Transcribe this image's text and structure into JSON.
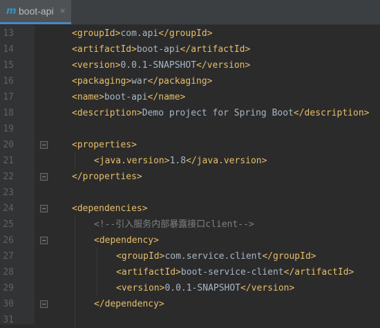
{
  "tab": {
    "label": "boot-api",
    "file_icon": "m",
    "close_glyph": "×"
  },
  "lines": [
    {
      "num": "13",
      "indent": 1,
      "parts": [
        {
          "k": "tag",
          "t": "<groupId>"
        },
        {
          "k": "txt",
          "t": "com.api"
        },
        {
          "k": "tag",
          "t": "</groupId>"
        }
      ]
    },
    {
      "num": "14",
      "indent": 1,
      "parts": [
        {
          "k": "tag",
          "t": "<artifactId>"
        },
        {
          "k": "txt",
          "t": "boot-api"
        },
        {
          "k": "tag",
          "t": "</artifactId>"
        }
      ]
    },
    {
      "num": "15",
      "indent": 1,
      "parts": [
        {
          "k": "tag",
          "t": "<version>"
        },
        {
          "k": "txt",
          "t": "0.0.1-SNAPSHOT"
        },
        {
          "k": "tag",
          "t": "</version>"
        }
      ]
    },
    {
      "num": "16",
      "indent": 1,
      "parts": [
        {
          "k": "tag",
          "t": "<packaging>"
        },
        {
          "k": "txt",
          "t": "war"
        },
        {
          "k": "tag",
          "t": "</packaging>"
        }
      ]
    },
    {
      "num": "17",
      "indent": 1,
      "parts": [
        {
          "k": "tag",
          "t": "<name>"
        },
        {
          "k": "txt",
          "t": "boot-api"
        },
        {
          "k": "tag",
          "t": "</name>"
        }
      ]
    },
    {
      "num": "18",
      "indent": 1,
      "parts": [
        {
          "k": "tag",
          "t": "<description>"
        },
        {
          "k": "txt",
          "t": "Demo project for Spring Boot"
        },
        {
          "k": "tag",
          "t": "</description>"
        }
      ]
    },
    {
      "num": "19",
      "indent": 1,
      "parts": []
    },
    {
      "num": "20",
      "indent": 1,
      "fold": true,
      "parts": [
        {
          "k": "tag",
          "t": "<properties>"
        }
      ]
    },
    {
      "num": "21",
      "indent": 2,
      "parts": [
        {
          "k": "tag",
          "t": "<java.version>"
        },
        {
          "k": "txt",
          "t": "1.8"
        },
        {
          "k": "tag",
          "t": "</java.version>"
        }
      ]
    },
    {
      "num": "22",
      "indent": 1,
      "fold": true,
      "parts": [
        {
          "k": "tag",
          "t": "</properties>"
        }
      ]
    },
    {
      "num": "23",
      "indent": 1,
      "parts": []
    },
    {
      "num": "24",
      "indent": 1,
      "fold": true,
      "parts": [
        {
          "k": "tag",
          "t": "<dependencies>"
        }
      ]
    },
    {
      "num": "25",
      "indent": 2,
      "parts": [
        {
          "k": "cmt",
          "t": "<!--引入服务内部暴露接口client-->"
        }
      ]
    },
    {
      "num": "26",
      "indent": 2,
      "fold": true,
      "parts": [
        {
          "k": "tag",
          "t": "<dependency>"
        }
      ]
    },
    {
      "num": "27",
      "indent": 3,
      "parts": [
        {
          "k": "tag",
          "t": "<groupId>"
        },
        {
          "k": "txt",
          "t": "com.service.client"
        },
        {
          "k": "tag",
          "t": "</groupId>"
        }
      ]
    },
    {
      "num": "28",
      "indent": 3,
      "parts": [
        {
          "k": "tag",
          "t": "<artifactId>"
        },
        {
          "k": "txt",
          "t": "boot-service-client"
        },
        {
          "k": "tag",
          "t": "</artifactId>"
        }
      ]
    },
    {
      "num": "29",
      "indent": 3,
      "parts": [
        {
          "k": "tag",
          "t": "<version>"
        },
        {
          "k": "txt",
          "t": "0.0.1-SNAPSHOT"
        },
        {
          "k": "tag",
          "t": "</version>"
        }
      ]
    },
    {
      "num": "30",
      "indent": 2,
      "fold": true,
      "parts": [
        {
          "k": "tag",
          "t": "</dependency>"
        }
      ]
    },
    {
      "num": "31",
      "indent": 1,
      "parts": []
    }
  ]
}
